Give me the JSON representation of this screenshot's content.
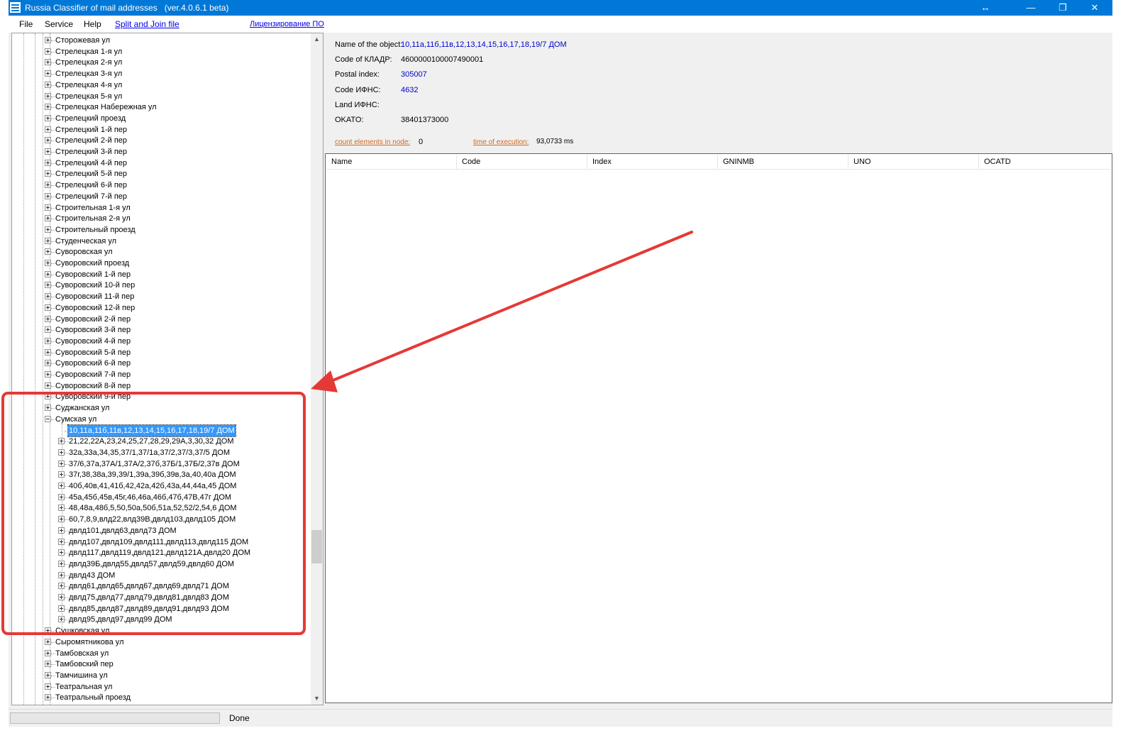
{
  "window": {
    "title": "Russia Classifier of mail addresses   (ver.4.0.6.1 beta)",
    "controls": {
      "resize": "↔",
      "minimize": "—",
      "restore": "❐",
      "close": "✕"
    }
  },
  "menu": {
    "file": "File",
    "service": "Service",
    "help": "Help",
    "split_join": "Split and Join file",
    "licensing": "Лицензирование ПО"
  },
  "tree": {
    "streets_top": [
      "Сторожевая ул",
      "Стрелецкая 1-я ул",
      "Стрелецкая 2-я ул",
      "Стрелецкая 3-я ул",
      "Стрелецкая 4-я ул",
      "Стрелецкая 5-я ул",
      "Стрелецкая Набережная ул",
      "Стрелецкий проезд",
      "Стрелецкий 1-й пер",
      "Стрелецкий 2-й пер",
      "Стрелецкий 3-й пер",
      "Стрелецкий 4-й пер",
      "Стрелецкий 5-й пер",
      "Стрелецкий 6-й пер",
      "Стрелецкий 7-й пер",
      "Строительная 1-я ул",
      "Строительная 2-я ул",
      "Строительный проезд",
      "Студенческая ул",
      "Суворовская ул",
      "Суворовский проезд",
      "Суворовский 1-й пер",
      "Суворовский 10-й пер",
      "Суворовский 11-й пер",
      "Суворовский 12-й пер",
      "Суворовский 2-й пер",
      "Суворовский 3-й пер",
      "Суворовский 4-й пер",
      "Суворовский 5-й пер",
      "Суворовский 6-й пер",
      "Суворовский 7-й пер",
      "Суворовский 8-й пер",
      "Суворовский 9-й пер",
      "Суджанская ул"
    ],
    "expanded_street": "Сумская ул",
    "selected_house": "10,11а,11б,11в,12,13,14,15,16,17,18,19/7 ДОМ",
    "houses": [
      "21,22,22А,23,24,25,27,28,29,29А,3,30,32 ДОМ",
      "32а,33а,34,35,37/1,37/1а,37/2,37/3,37/5 ДОМ",
      "37/6,37а,37А/1,37А/2,37б,37Б/1,37Б/2,37в ДОМ",
      "37г,38,38а,39,39/1,39а,39б,39в,3а,40,40а ДОМ",
      "40б,40в,41,41б,42,42а,42б,43а,44,44а,45 ДОМ",
      "45а,45б,45в,45г,46,46а,46б,47б,47В,47г ДОМ",
      "48,48а,48б,5,50,50а,50б,51а,52,52/2,54,6 ДОМ",
      "60,7,8,9,влд22,влд39В,двлд103,двлд105 ДОМ",
      "двлд101,двлд63,двлд73 ДОМ",
      "двлд107,двлд109,двлд111,двлд113,двлд115 ДОМ",
      "двлд117,двлд119,двлд121,двлд121А,двлд20 ДОМ",
      "двлд39Б,двлд55,двлд57,двлд59,двлд60 ДОМ",
      "двлд43 ДОМ",
      "двлд61,двлд65,двлд67,двлд69,двлд71 ДОМ",
      "двлд75,двлд77,двлд79,двлд81,двлд83 ДОМ",
      "двлд85,двлд87,двлд89,двлд91,двлд93 ДОМ",
      "двлд95,двлд97,двлд99 ДОМ"
    ],
    "streets_bottom": [
      "Сушковская ул",
      "Сыромятникова ул",
      "Тамбовская ул",
      "Тамбовский пер",
      "Тамчишина ул",
      "Театральная ул",
      "Театральный проезд"
    ]
  },
  "info": {
    "name_label": "Name of the object:",
    "name_value": "10,11а,11б,11в,12,13,14,15,16,17,18,19/7 ДОМ",
    "code_label": "Code of КЛАДР:",
    "code_value": "4600000100007490001",
    "postal_label": "Postal index:",
    "postal_value": "305007",
    "ifns_label": "Code ИФНС:",
    "ifns_value": "4632",
    "land_label": "Land ИФНС:",
    "land_value": "",
    "okato_label": "OKATO:",
    "okato_value": "38401373000",
    "count_label": "count elements in node:",
    "count_value": "0",
    "time_label": "time of execution:",
    "time_value": "93,0733 ms"
  },
  "grid": {
    "columns": [
      "Name",
      "Code",
      "Index",
      "GNINMB",
      "UNO",
      "OCATD"
    ]
  },
  "status": {
    "text": "Done",
    "progress": 0
  },
  "colors": {
    "annotation": "#e53935",
    "selection": "#3399ff",
    "link": "#0000cc",
    "orange_link": "#d2691e"
  }
}
